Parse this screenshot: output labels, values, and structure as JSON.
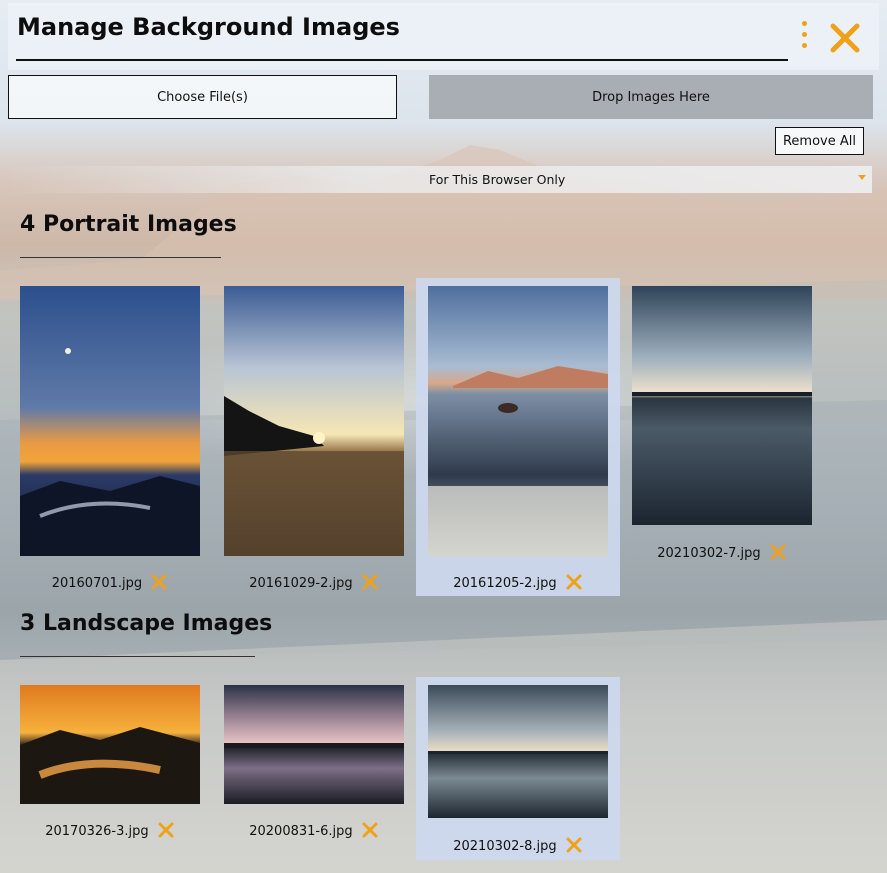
{
  "header": {
    "title": "Manage Background Images",
    "menu_icon": "vertical-dots-icon",
    "close_icon": "close-x-icon"
  },
  "toolbar": {
    "choose_label": "Choose File(s)",
    "drop_label": "Drop Images Here",
    "remove_all_label": "Remove All",
    "scope_value": "For This Browser Only"
  },
  "portrait": {
    "title": "4 Portrait Images",
    "images": [
      {
        "name": "20160701.jpg"
      },
      {
        "name": "20161029-2.jpg"
      },
      {
        "name": "20161205-2.jpg",
        "selected": true
      },
      {
        "name": "20210302-7.jpg"
      }
    ]
  },
  "landscape": {
    "title": "3 Landscape Images",
    "images": [
      {
        "name": "20170326-3.jpg"
      },
      {
        "name": "20200831-6.jpg"
      },
      {
        "name": "20210302-8.jpg",
        "selected": true
      }
    ]
  },
  "colors": {
    "accent": "#f0a11a",
    "selected_card": "#cdd8ee"
  }
}
